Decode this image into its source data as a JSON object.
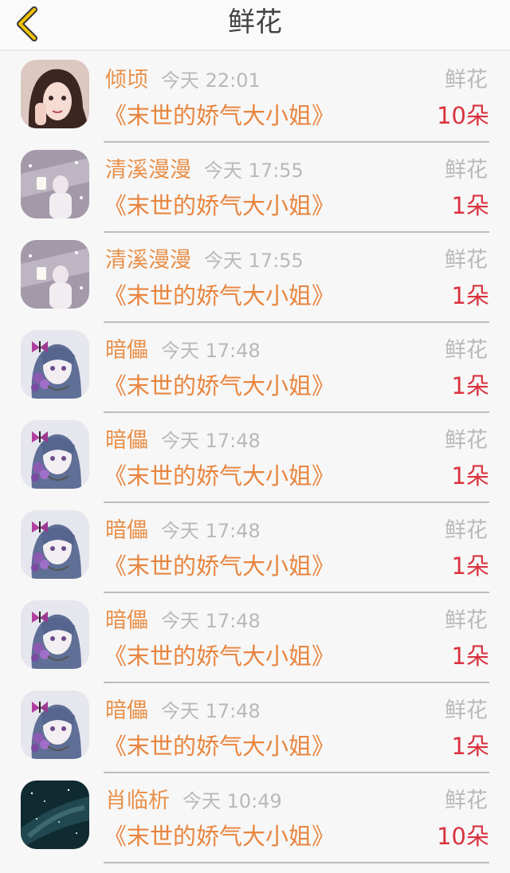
{
  "header": {
    "title": "鲜花",
    "back_icon": "chevron-left-icon",
    "accent_color": "#f2c200"
  },
  "items": [
    {
      "name": "倾顷",
      "time": "今天 22:01",
      "book": "《末世的娇气大小姐》",
      "gift": "鲜花",
      "count": "10朵",
      "avatar": "girl-photo"
    },
    {
      "name": "清溪漫漫",
      "time": "今天 17:55",
      "book": "《末世的娇气大小姐》",
      "gift": "鲜花",
      "count": "1朵",
      "avatar": "snow-photo"
    },
    {
      "name": "清溪漫漫",
      "time": "今天 17:55",
      "book": "《末世的娇气大小姐》",
      "gift": "鲜花",
      "count": "1朵",
      "avatar": "snow-photo"
    },
    {
      "name": "暗儡",
      "time": "今天 17:48",
      "book": "《末世的娇气大小姐》",
      "gift": "鲜花",
      "count": "1朵",
      "avatar": "anime-butterfly"
    },
    {
      "name": "暗儡",
      "time": "今天 17:48",
      "book": "《末世的娇气大小姐》",
      "gift": "鲜花",
      "count": "1朵",
      "avatar": "anime-butterfly"
    },
    {
      "name": "暗儡",
      "time": "今天 17:48",
      "book": "《末世的娇气大小姐》",
      "gift": "鲜花",
      "count": "1朵",
      "avatar": "anime-butterfly"
    },
    {
      "name": "暗儡",
      "time": "今天 17:48",
      "book": "《末世的娇气大小姐》",
      "gift": "鲜花",
      "count": "1朵",
      "avatar": "anime-butterfly"
    },
    {
      "name": "暗儡",
      "time": "今天 17:48",
      "book": "《末世的娇气大小姐》",
      "gift": "鲜花",
      "count": "1朵",
      "avatar": "anime-butterfly"
    },
    {
      "name": "肖临析",
      "time": "今天 10:49",
      "book": "《末世的娇气大小姐》",
      "gift": "鲜花",
      "count": "10朵",
      "avatar": "night-sky"
    }
  ]
}
